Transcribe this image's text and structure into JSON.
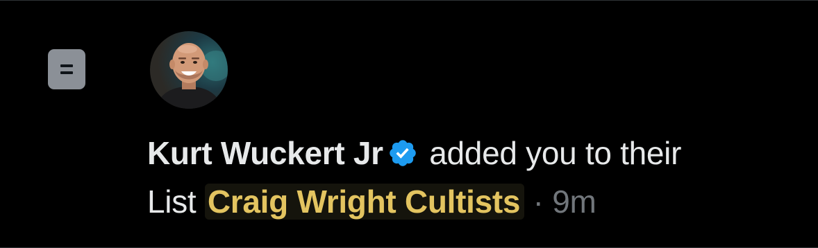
{
  "notification": {
    "user_name": "Kurt Wuckert Jr",
    "action_text": "added you to their",
    "list_word": "List",
    "list_name": "Craig Wright Cultists",
    "separator": "·",
    "time": "9m",
    "icons": {
      "type_icon": "list-icon",
      "badge_icon": "verified-badge-icon"
    },
    "colors": {
      "background": "#000000",
      "text": "#e7e9ea",
      "list_highlight": "#e3c460",
      "verified_blue": "#1d9bf0",
      "muted": "#71767b"
    }
  }
}
